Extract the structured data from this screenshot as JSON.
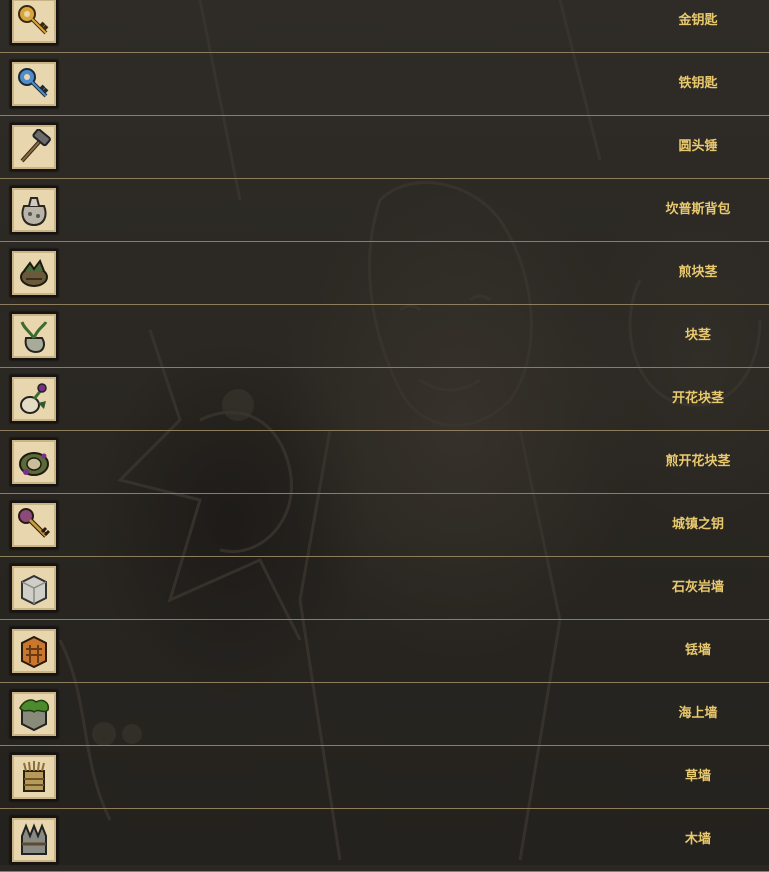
{
  "items": [
    {
      "name": "金钥匙",
      "icon": "golden-key-icon"
    },
    {
      "name": "铁钥匙",
      "icon": "iron-key-icon"
    },
    {
      "name": "圆头锤",
      "icon": "ball-pein-hammer-icon"
    },
    {
      "name": "坎普斯背包",
      "icon": "krampus-sack-icon"
    },
    {
      "name": "煎块茎",
      "icon": "cooked-tuber-icon"
    },
    {
      "name": "块茎",
      "icon": "tuber-icon"
    },
    {
      "name": "开花块茎",
      "icon": "blooming-tuber-icon"
    },
    {
      "name": "煎开花块茎",
      "icon": "cooked-blooming-tuber-icon"
    },
    {
      "name": "城镇之钥",
      "icon": "key-to-the-city-icon"
    },
    {
      "name": "石灰岩墙",
      "icon": "limestone-wall-icon"
    },
    {
      "name": "铥墙",
      "icon": "thulecite-wall-icon"
    },
    {
      "name": "海上墙",
      "icon": "sea-wall-icon"
    },
    {
      "name": "草墙",
      "icon": "hay-wall-icon"
    },
    {
      "name": "木墙",
      "icon": "wood-wall-icon"
    }
  ],
  "colors": {
    "label": "#e9c96e",
    "divider": "#8c7e5d",
    "frame": "#e8d6ae"
  }
}
